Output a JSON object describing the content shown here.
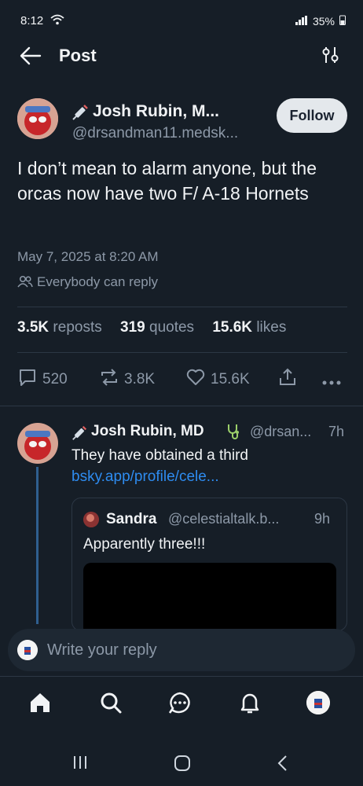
{
  "status": {
    "time": "8:12",
    "battery": "35%"
  },
  "header": {
    "title": "Post"
  },
  "post": {
    "author_name": "Josh Rubin, M...",
    "author_handle": "@drsandman11.medsk...",
    "follow_label": "Follow",
    "text": "I don’t mean to alarm anyone, but the orcas now have two F/ A-18 Hornets",
    "timestamp": "May 7, 2025 at 8:20 AM",
    "reply_setting": "Everybody can reply",
    "stats": {
      "reposts_count": "3.5K",
      "reposts_label": "reposts",
      "quotes_count": "319",
      "quotes_label": "quotes",
      "likes_count": "15.6K",
      "likes_label": "likes"
    },
    "actions": {
      "replies": "520",
      "reposts": "3.8K",
      "likes": "15.6K"
    }
  },
  "reply": {
    "author_name": "Josh Rubin, MD",
    "author_handle": "@drsan...",
    "time": "7h",
    "text": "They have obtained a third",
    "link": "bsky.app/profile/cele...",
    "quote": {
      "author_name": "Sandra",
      "author_handle": "@celestialtalk.b...",
      "time": "9h",
      "text": "Apparently three!!!"
    }
  },
  "compose": {
    "placeholder": "Write your reply"
  },
  "colors": {
    "background": "#161e27",
    "accent": "#2e8cf0",
    "muted": "#8d99a8"
  }
}
